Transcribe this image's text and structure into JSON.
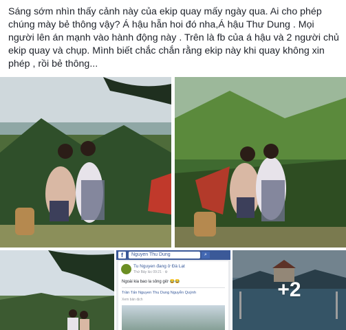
{
  "post": {
    "text": "Sáng sớm nhìn thấy cảnh này của ekip quay mấy ngày qua. Ai cho phép chúng mày bẻ thông vậy? Á hậu hẵn hoi đó nha,Á hậu Thư Dung . Mọi người lên án mạnh vào hành động này . Trên là fb của á hậu và 2 người chủ ekip quay và chụp. Mình biết chắc chắn rằng ekip này khi quay không xin phép , rồi bẻ thông..."
  },
  "photos": {
    "fb_screenshot": {
      "logo": "f",
      "search_text": "Nguyen Thu Dung",
      "search_icon": "search-icon",
      "author": "Tu Nguyen đang ở Đà Lạt",
      "time": "Thứ Bảy lúc 09:21 · ⚙",
      "caption": "Ngoài kia bao la sông giờ 😂😂",
      "tags": "Trần Tấn Nguyen Thu Dung Nguyễn Quỳnh",
      "see_translation": "Xem bản dịch"
    },
    "more_count": "+2"
  },
  "colors": {
    "facebook_blue": "#3b5998",
    "link_blue": "#365899",
    "text": "#1d2129"
  }
}
